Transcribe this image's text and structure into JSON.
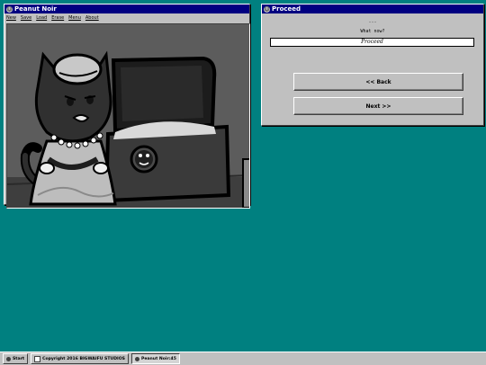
{
  "game_window": {
    "title": "Peanut Noir",
    "menu": [
      "New",
      "Save",
      "Load",
      "Erase",
      "Menu",
      "About"
    ]
  },
  "prompt_window": {
    "title": "Proceed",
    "ellipsis": "...",
    "question": "What now?",
    "answer_value": "Proceed",
    "back_label": "<< Back",
    "next_label": "Next >>"
  },
  "taskbar": {
    "start_label": "Start",
    "copyright": "Copyright 2016 BIGWAIFU STUDIOS",
    "task_label": "Peanut Noir:45"
  },
  "colors": {
    "desktop": "#008080",
    "titlebar": "#000080",
    "chrome": "#c0c0c0"
  }
}
